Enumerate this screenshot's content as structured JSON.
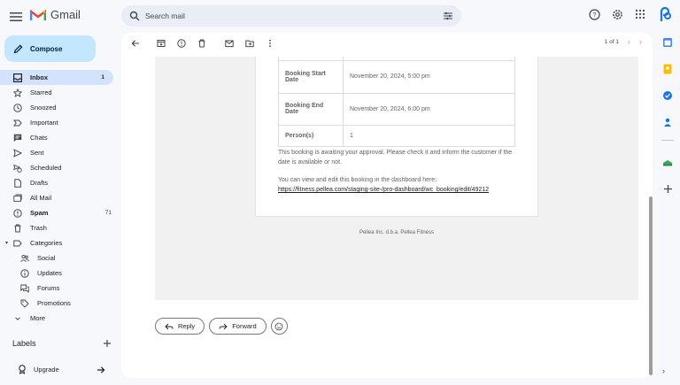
{
  "app": {
    "name": "Gmail",
    "search_placeholder": "Search mail"
  },
  "compose_label": "Compose",
  "nav": [
    {
      "label": "Inbox",
      "count": "1",
      "icon": "inbox-icon",
      "active": true
    },
    {
      "label": "Starred",
      "count": "",
      "icon": "star-icon"
    },
    {
      "label": "Snoozed",
      "count": "",
      "icon": "clock-icon"
    },
    {
      "label": "Important",
      "count": "",
      "icon": "important-icon"
    },
    {
      "label": "Chats",
      "count": "",
      "icon": "chat-icon"
    },
    {
      "label": "Sent",
      "count": "",
      "icon": "send-icon"
    },
    {
      "label": "Scheduled",
      "count": "",
      "icon": "scheduled-send-icon"
    },
    {
      "label": "Drafts",
      "count": "",
      "icon": "draft-icon"
    },
    {
      "label": "All Mail",
      "count": "",
      "icon": "all-mail-icon"
    },
    {
      "label": "Spam",
      "count": "71",
      "icon": "spam-icon",
      "bold": true
    },
    {
      "label": "Trash",
      "count": "",
      "icon": "trash-icon"
    },
    {
      "label": "Categories",
      "count": "",
      "icon": "label-icon"
    },
    {
      "label": "Social",
      "count": "",
      "icon": "people-icon",
      "sub": true
    },
    {
      "label": "Updates",
      "count": "",
      "icon": "info-icon",
      "sub": true
    },
    {
      "label": "Forums",
      "count": "",
      "icon": "forum-icon",
      "sub": true
    },
    {
      "label": "Promotions",
      "count": "",
      "icon": "tag-icon",
      "sub": true
    },
    {
      "label": "More",
      "count": "",
      "icon": "chevron-down-icon"
    }
  ],
  "labels_title": "Labels",
  "upgrade_label": "Upgrade",
  "pager_text": "1 of 1",
  "booking": [
    {
      "key": "Booking Start Date",
      "value": "November 20, 2024, 5:00 pm"
    },
    {
      "key": "Booking End Date",
      "value": "November 20, 2024, 6:00 pm"
    },
    {
      "key": "Person(s)",
      "value": "1"
    }
  ],
  "message_1": "This booking is awaiting your approval. Please check it and inform the customer if the date is available or not.",
  "message_2": "You can view and edit this booking in the dashboard here:",
  "dashboard_link": "https://fitness.pellea.com/staging-site-/pro-dashboard/wc_booking/edit/49212",
  "footer_note": "Pellea Inc. d.b.a. Pellea Fitness",
  "reply_label": "Reply",
  "forward_label": "Forward",
  "colors": {
    "accent": "#c2e7ff",
    "active_nav": "#d3e3fd",
    "search_bg": "#e9eef6"
  }
}
